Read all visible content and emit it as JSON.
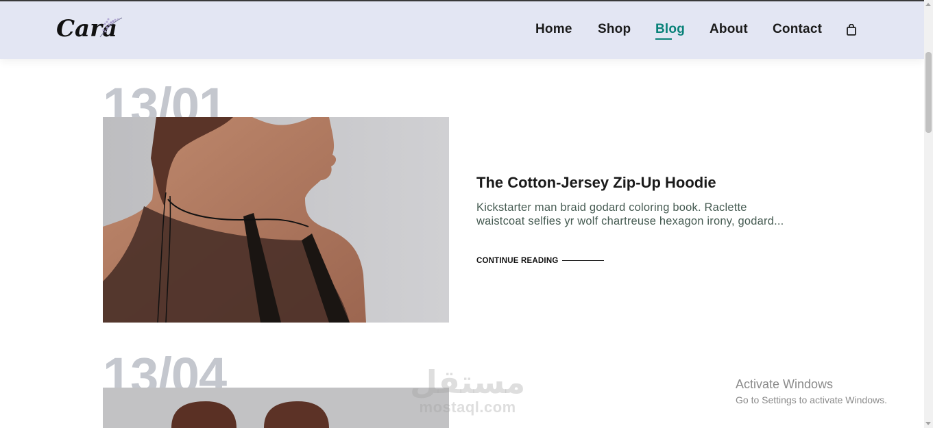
{
  "header": {
    "logo_text": "Cara",
    "nav": [
      {
        "label": "Home"
      },
      {
        "label": "Shop"
      },
      {
        "label": "Blog"
      },
      {
        "label": "About"
      },
      {
        "label": "Contact"
      }
    ],
    "active_item": "Blog",
    "cart_icon": "shopping-bag-icon"
  },
  "posts": [
    {
      "date": "13/01",
      "title": "The Cotton-Jersey Zip-Up Hoodie",
      "excerpt": "Kickstarter man braid godard coloring book. Raclette waistcoat selfies yr wolf chartreuse hexagon irony, godard...",
      "read_more": "CONTINUE READING"
    },
    {
      "date": "13/04"
    }
  ],
  "watermark": {
    "arabic": "مستقل",
    "latin": "mostaql.com"
  },
  "os_notice": {
    "title": "Activate Windows",
    "subtitle": "Go to Settings to activate Windows."
  },
  "colors": {
    "header_bg": "#e3e6f3",
    "accent": "#088178",
    "date_gray": "#c4c7ce"
  }
}
